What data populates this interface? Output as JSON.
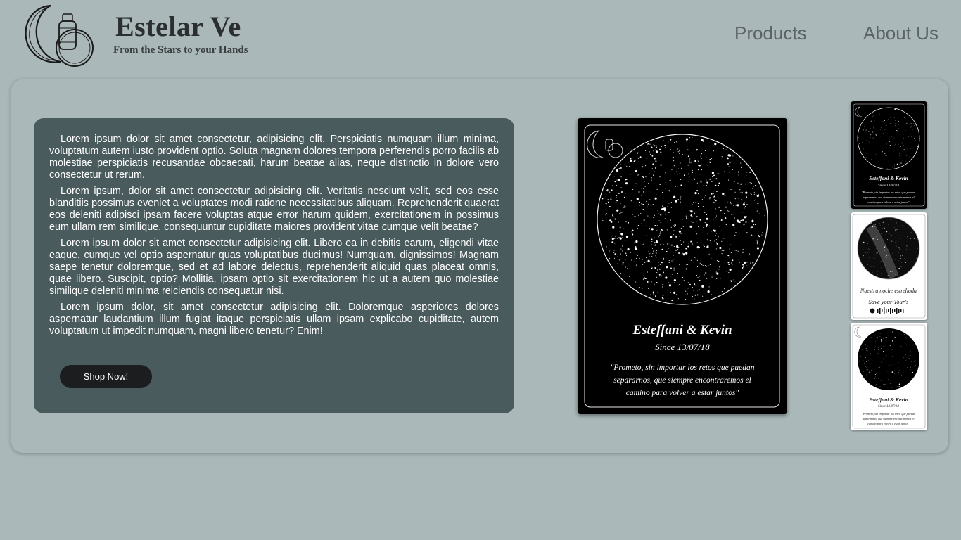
{
  "brand": {
    "title": "Estelar Ve",
    "tagline": "From the Stars to your Hands",
    "logo_icon": "moon-ring-perfume-logo"
  },
  "nav": {
    "products": "Products",
    "about": "About Us"
  },
  "description": {
    "paragraphs": [
      "Lorem ipsum dolor sit amet consectetur, adipisicing elit. Perspiciatis numquam illum minima, voluptatum autem iusto provident optio. Soluta magnam dolores tempora perferendis porro facilis ab molestiae perspiciatis recusandae obcaecati, harum beatae alias, neque distinctio in dolore vero consectetur ut rerum.",
      "Lorem ipsum, dolor sit amet consectetur adipisicing elit. Veritatis nesciunt velit, sed eos esse blanditiis possimus eveniet a voluptates modi ratione necessitatibus aliquam. Reprehenderit quaerat eos deleniti adipisci ipsam facere voluptas atque error harum quidem, exercitationem in possimus eum ullam rem similique, consequuntur cupiditate maiores provident vitae cumque velit beatae?",
      "Lorem ipsum dolor sit amet consectetur adipisicing elit. Libero ea in debitis earum, eligendi vitae eaque, cumque vel optio aspernatur quas voluptatibus ducimus! Numquam, dignissimos! Magnam saepe tenetur doloremque, sed et ad labore delectus, reprehenderit aliquid quas placeat omnis, quae libero. Suscipit, optio? Mollitia, ipsam optio sit exercitationem hic ut a autem quo molestiae similique deleniti minima reiciendis consequatur nisi.",
      "Lorem ipsum dolor, sit amet consectetur adipisicing elit. Doloremque asperiores dolores aspernatur laudantium illum fugiat itaque perspiciatis ullam ipsam explicabo cupiditate, autem voluptatum ut impedit numquam, magni libero tenetur? Enim!"
    ],
    "button": "Shop Now!"
  },
  "poster": {
    "names": "Esteffani & Kevin",
    "since": "Since 13/07/18",
    "quote_line1": "\"Prometo, sin importar los retos que puedan",
    "quote_line2": "separarnos, que siempre encontraremos el",
    "quote_line3": "camino para volver a estar juntos\""
  },
  "thumbnail_2": {
    "caption": "Nuestra noche estrellada",
    "signature": "Save your Tour's"
  },
  "colors": {
    "page_bg": "#aab8b9",
    "text_card_bg": "#4a5b5e",
    "button_bg": "#1b1d1e",
    "nav_text": "#5b6466"
  }
}
